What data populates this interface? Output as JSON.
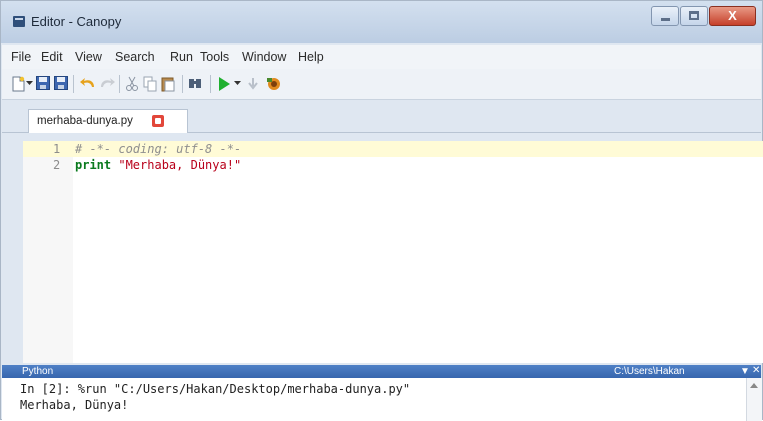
{
  "window": {
    "title": "Editor - Canopy",
    "close_glyph": "X"
  },
  "menu": [
    "File",
    "Edit",
    "View",
    "Search",
    "Run",
    "Tools",
    "Window",
    "Help"
  ],
  "toolbar": {
    "icons": [
      "new-file-icon",
      "dropdown-icon",
      "save-icon",
      "save-all-icon",
      "undo-icon",
      "redo-icon",
      "cut-icon",
      "copy-icon",
      "paste-icon",
      "find-icon",
      "run-icon",
      "run-dropdown-icon",
      "debug-icon",
      "package-manager-icon"
    ]
  },
  "tab": {
    "label": "merhaba-dunya.py"
  },
  "editor": {
    "lines": [
      {
        "number": "1",
        "comment": "# -*- coding: utf-8 -*-"
      },
      {
        "number": "2",
        "keyword": "print",
        "string": "\"Merhaba, Dünya!\""
      }
    ]
  },
  "shell": {
    "title": "Python",
    "path": "C:\\Users\\Hakan",
    "dropdown_glyph": "▼",
    "close_glyph": "✕",
    "prompt": "In [2]:",
    "command": " %run \"C:/Users/Hakan/Desktop/merhaba-dunya.py\"",
    "output": "Merhaba, Dünya!"
  },
  "colors": {
    "run_green": "#20b030",
    "shell_header": "#3766ae",
    "keyword_green": "#0b7a1e",
    "string_red": "#b8001a"
  }
}
